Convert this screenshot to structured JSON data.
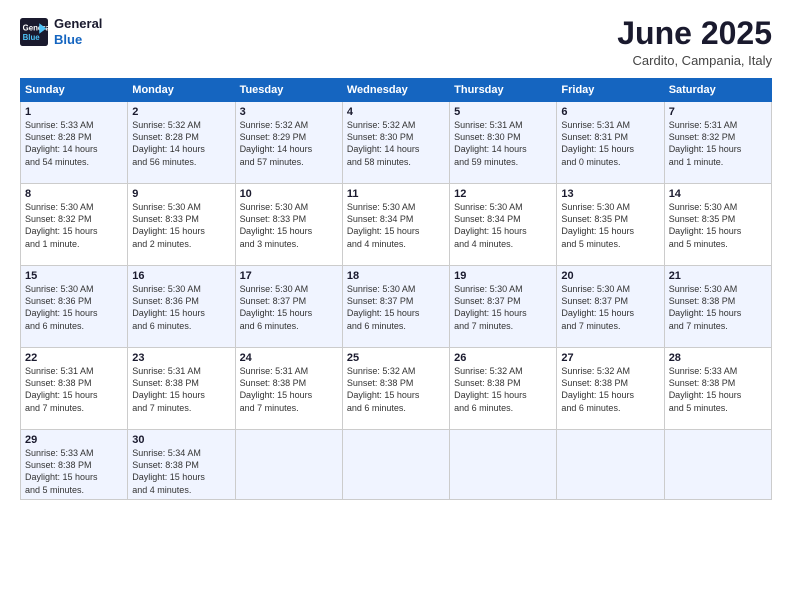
{
  "logo": {
    "line1": "General",
    "line2": "Blue"
  },
  "title": "June 2025",
  "location": "Cardito, Campania, Italy",
  "weekdays": [
    "Sunday",
    "Monday",
    "Tuesday",
    "Wednesday",
    "Thursday",
    "Friday",
    "Saturday"
  ],
  "weeks": [
    [
      {
        "day": "1",
        "info": "Sunrise: 5:33 AM\nSunset: 8:28 PM\nDaylight: 14 hours\nand 54 minutes."
      },
      {
        "day": "2",
        "info": "Sunrise: 5:32 AM\nSunset: 8:28 PM\nDaylight: 14 hours\nand 56 minutes."
      },
      {
        "day": "3",
        "info": "Sunrise: 5:32 AM\nSunset: 8:29 PM\nDaylight: 14 hours\nand 57 minutes."
      },
      {
        "day": "4",
        "info": "Sunrise: 5:32 AM\nSunset: 8:30 PM\nDaylight: 14 hours\nand 58 minutes."
      },
      {
        "day": "5",
        "info": "Sunrise: 5:31 AM\nSunset: 8:30 PM\nDaylight: 14 hours\nand 59 minutes."
      },
      {
        "day": "6",
        "info": "Sunrise: 5:31 AM\nSunset: 8:31 PM\nDaylight: 15 hours\nand 0 minutes."
      },
      {
        "day": "7",
        "info": "Sunrise: 5:31 AM\nSunset: 8:32 PM\nDaylight: 15 hours\nand 1 minute."
      }
    ],
    [
      {
        "day": "8",
        "info": "Sunrise: 5:30 AM\nSunset: 8:32 PM\nDaylight: 15 hours\nand 1 minute."
      },
      {
        "day": "9",
        "info": "Sunrise: 5:30 AM\nSunset: 8:33 PM\nDaylight: 15 hours\nand 2 minutes."
      },
      {
        "day": "10",
        "info": "Sunrise: 5:30 AM\nSunset: 8:33 PM\nDaylight: 15 hours\nand 3 minutes."
      },
      {
        "day": "11",
        "info": "Sunrise: 5:30 AM\nSunset: 8:34 PM\nDaylight: 15 hours\nand 4 minutes."
      },
      {
        "day": "12",
        "info": "Sunrise: 5:30 AM\nSunset: 8:34 PM\nDaylight: 15 hours\nand 4 minutes."
      },
      {
        "day": "13",
        "info": "Sunrise: 5:30 AM\nSunset: 8:35 PM\nDaylight: 15 hours\nand 5 minutes."
      },
      {
        "day": "14",
        "info": "Sunrise: 5:30 AM\nSunset: 8:35 PM\nDaylight: 15 hours\nand 5 minutes."
      }
    ],
    [
      {
        "day": "15",
        "info": "Sunrise: 5:30 AM\nSunset: 8:36 PM\nDaylight: 15 hours\nand 6 minutes."
      },
      {
        "day": "16",
        "info": "Sunrise: 5:30 AM\nSunset: 8:36 PM\nDaylight: 15 hours\nand 6 minutes."
      },
      {
        "day": "17",
        "info": "Sunrise: 5:30 AM\nSunset: 8:37 PM\nDaylight: 15 hours\nand 6 minutes."
      },
      {
        "day": "18",
        "info": "Sunrise: 5:30 AM\nSunset: 8:37 PM\nDaylight: 15 hours\nand 6 minutes."
      },
      {
        "day": "19",
        "info": "Sunrise: 5:30 AM\nSunset: 8:37 PM\nDaylight: 15 hours\nand 7 minutes."
      },
      {
        "day": "20",
        "info": "Sunrise: 5:30 AM\nSunset: 8:37 PM\nDaylight: 15 hours\nand 7 minutes."
      },
      {
        "day": "21",
        "info": "Sunrise: 5:30 AM\nSunset: 8:38 PM\nDaylight: 15 hours\nand 7 minutes."
      }
    ],
    [
      {
        "day": "22",
        "info": "Sunrise: 5:31 AM\nSunset: 8:38 PM\nDaylight: 15 hours\nand 7 minutes."
      },
      {
        "day": "23",
        "info": "Sunrise: 5:31 AM\nSunset: 8:38 PM\nDaylight: 15 hours\nand 7 minutes."
      },
      {
        "day": "24",
        "info": "Sunrise: 5:31 AM\nSunset: 8:38 PM\nDaylight: 15 hours\nand 7 minutes."
      },
      {
        "day": "25",
        "info": "Sunrise: 5:32 AM\nSunset: 8:38 PM\nDaylight: 15 hours\nand 6 minutes."
      },
      {
        "day": "26",
        "info": "Sunrise: 5:32 AM\nSunset: 8:38 PM\nDaylight: 15 hours\nand 6 minutes."
      },
      {
        "day": "27",
        "info": "Sunrise: 5:32 AM\nSunset: 8:38 PM\nDaylight: 15 hours\nand 6 minutes."
      },
      {
        "day": "28",
        "info": "Sunrise: 5:33 AM\nSunset: 8:38 PM\nDaylight: 15 hours\nand 5 minutes."
      }
    ],
    [
      {
        "day": "29",
        "info": "Sunrise: 5:33 AM\nSunset: 8:38 PM\nDaylight: 15 hours\nand 5 minutes."
      },
      {
        "day": "30",
        "info": "Sunrise: 5:34 AM\nSunset: 8:38 PM\nDaylight: 15 hours\nand 4 minutes."
      },
      {
        "day": "",
        "info": ""
      },
      {
        "day": "",
        "info": ""
      },
      {
        "day": "",
        "info": ""
      },
      {
        "day": "",
        "info": ""
      },
      {
        "day": "",
        "info": ""
      }
    ]
  ]
}
